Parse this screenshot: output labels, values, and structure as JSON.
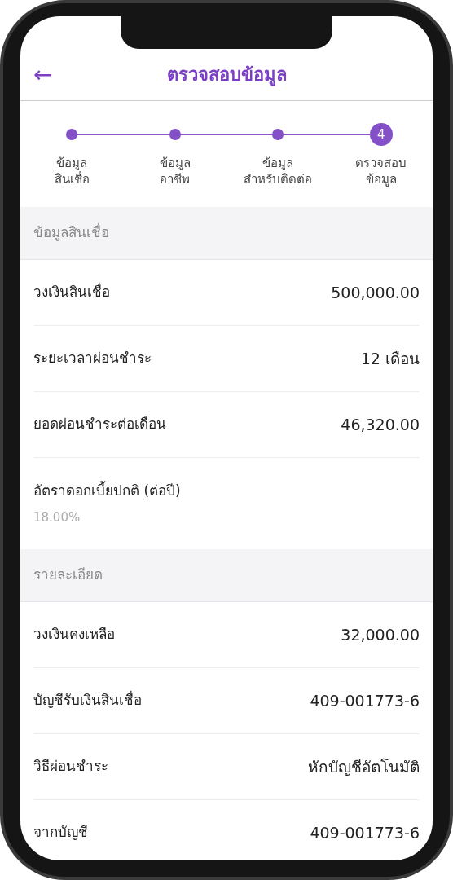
{
  "header": {
    "back_icon": "←",
    "title": "ตรวจสอบข้อมูล"
  },
  "stepper": [
    {
      "label": "ข้อมูล\nสินเชื่อ",
      "current": false
    },
    {
      "label": "ข้อมูล\nอาชีพ",
      "current": false
    },
    {
      "label": "ข้อมูล\nสำหรับติดต่อ",
      "current": false
    },
    {
      "label": "ตรวจสอบ\nข้อมูล",
      "current": true,
      "number": "4"
    }
  ],
  "sections": [
    {
      "title": "ข้อมูลสินเชื่อ",
      "rows": [
        {
          "kind": "inline",
          "label": "วงเงินสินเชื่อ",
          "value": "500,000.00"
        },
        {
          "kind": "inline",
          "label": "ระยะเวลาผ่อนชำระ",
          "value": "12 เดือน"
        },
        {
          "kind": "inline",
          "label": "ยอดผ่อนชำระต่อเดือน",
          "value": "46,320.00"
        },
        {
          "kind": "stacked",
          "label": "อัตราดอกเบี้ยปกติ (ต่อปี)",
          "value": "18.00%"
        }
      ]
    },
    {
      "title": "รายละเอียด",
      "rows": [
        {
          "kind": "inline",
          "label": "วงเงินคงเหลือ",
          "value": "32,000.00"
        },
        {
          "kind": "inline",
          "label": "บัญชีรับเงินสินเชื่อ",
          "value": "409-001773-6"
        },
        {
          "kind": "inline",
          "label": "วิธีผ่อนชำระ",
          "value": "หักบัญชีอัตโนมัติ"
        },
        {
          "kind": "inline",
          "label": "จากบัญชี",
          "value": "409-001773-6"
        }
      ]
    }
  ]
}
